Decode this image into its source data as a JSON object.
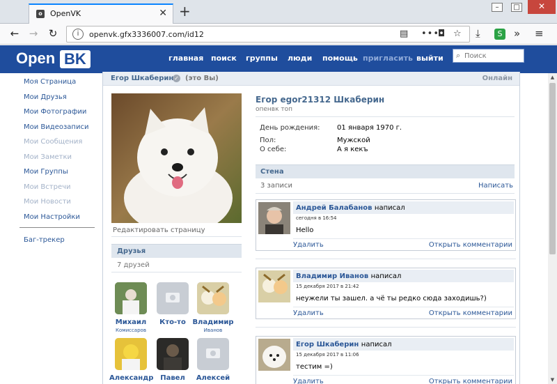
{
  "browser": {
    "tab_title": "OpenVK",
    "url": "openvk.gfx3336007.com/id12"
  },
  "site": {
    "logo_open": "Open",
    "logo_vk": "BK",
    "nav": [
      "главная",
      "поиск",
      "группы",
      "люди",
      "помощь",
      "пригласить",
      "выйти"
    ],
    "search_placeholder": "Поиск"
  },
  "leftmenu": {
    "items": [
      "Моя Страница",
      "Мои Друзья",
      "Мои Фотографии",
      "Мои Видеозаписи",
      "Мои Сообщения",
      "Мои Заметки",
      "Мои Группы",
      "Мои Встречи",
      "Мои Новости",
      "Мои Настройки"
    ],
    "bugtracker": "Баг-трекер"
  },
  "profile": {
    "bar_name": "Егор Шкаберин",
    "bar_you": "(это Вы)",
    "online": "Онлайн",
    "full_name": "Егор egor21312 Шкаберин",
    "status": "опенвк топ",
    "edit_link": "Редактировать страницу",
    "info": [
      {
        "label": "День рождения:",
        "value": "01 января 1970 г."
      },
      {
        "label": "Пол:",
        "value": "Мужской"
      },
      {
        "label": "О себе:",
        "value": "А я кекъ"
      }
    ]
  },
  "friends": {
    "title": "Друзья",
    "count": "7 друзей",
    "list": [
      {
        "name": "Михаил",
        "sub": "Комиссаров"
      },
      {
        "name": "Кто-то",
        "sub": ""
      },
      {
        "name": "Владимир",
        "sub": "Иванов"
      },
      {
        "name": "Александр",
        "sub": ""
      },
      {
        "name": "Павел",
        "sub": ""
      },
      {
        "name": "Алексей",
        "sub": ""
      }
    ]
  },
  "wall": {
    "title": "Стена",
    "count": "3 записи",
    "write": "Написать",
    "posts": [
      {
        "author": "Андрей Балабанов",
        "action": "написал",
        "date": "сегодня в 16:54",
        "text": "Hello",
        "delete": "Удалить",
        "comments": "Открыть комментарии"
      },
      {
        "author": "Владимир Иванов",
        "action": "написал",
        "date": "15 декабря 2017 в 21:42",
        "text": "неужели ты зашел. а чё ты редко сюда заходишь?)",
        "delete": "Удалить",
        "comments": "Открыть комментарии"
      },
      {
        "author": "Егор Шкаберин",
        "action": "написал",
        "date": "15 декабря 2017 в 11:06",
        "text": "тестим =)",
        "delete": "Удалить",
        "comments": "Открыть комментарии"
      }
    ]
  },
  "colors": {
    "header": "#1f4d9d",
    "link": "#2b5797",
    "bar": "#dfe6ee"
  }
}
